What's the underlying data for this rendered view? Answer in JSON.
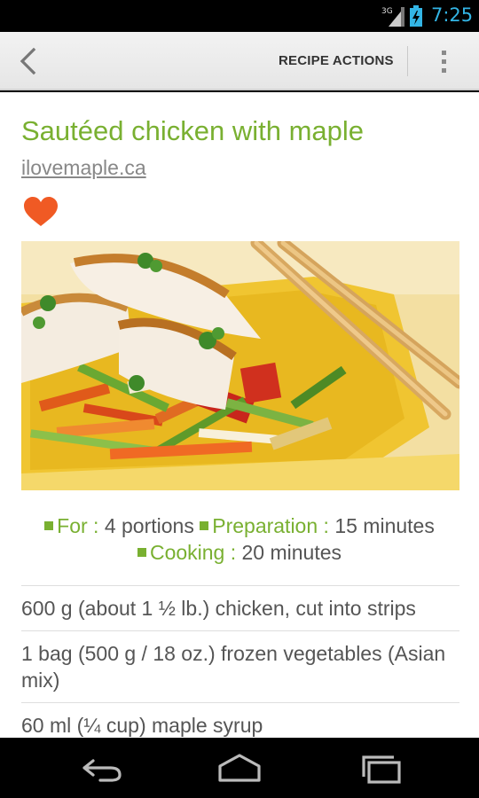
{
  "status_bar": {
    "network": "3G",
    "time": "7:25",
    "accent_color": "#33b5e5"
  },
  "action_bar": {
    "back_icon": "back-chevron-icon",
    "actions_label": "RECIPE ACTIONS",
    "overflow_icon": "overflow-menu-icon"
  },
  "recipe": {
    "title": "Sautéed chicken with maple",
    "source": "ilovemaple.ca",
    "favorite_icon": "heart-icon",
    "favorite_color": "#f05a24",
    "title_color": "#79b031",
    "meta": {
      "for_label": "For :",
      "for_value": "4 portions",
      "prep_label": "Preparation :",
      "prep_value": "15 minutes",
      "cook_label": "Cooking :",
      "cook_value": "20 minutes"
    },
    "ingredients": [
      "600 g (about 1 ½ lb.) chicken, cut into strips",
      "1 bag (500 g / 18 oz.) frozen vegetables (Asian mix)",
      "60 ml (¼ cup) maple syrup"
    ]
  },
  "nav_bar": {
    "back_icon": "nav-back-icon",
    "home_icon": "nav-home-icon",
    "recents_icon": "nav-recents-icon"
  }
}
